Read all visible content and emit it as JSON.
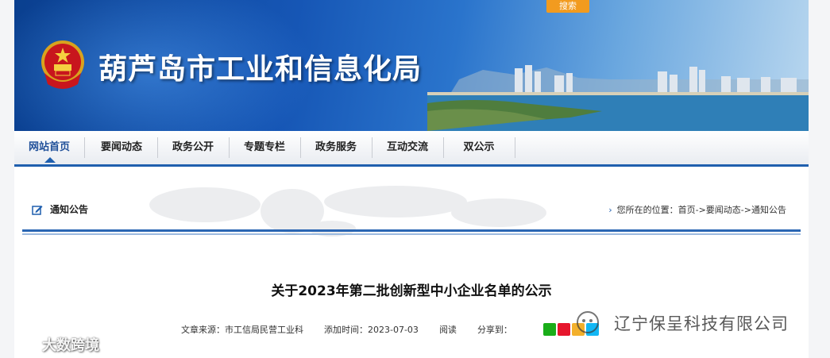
{
  "header": {
    "site_title": "葫芦岛市工业和信息化局",
    "search_label": "搜索"
  },
  "nav": {
    "items": [
      {
        "label": "网站首页",
        "active": true
      },
      {
        "label": "要闻动态"
      },
      {
        "label": "政务公开"
      },
      {
        "label": "专题专栏"
      },
      {
        "label": "政务服务"
      },
      {
        "label": "互动交流"
      },
      {
        "label": "双公示"
      }
    ]
  },
  "section": {
    "title": "通知公告",
    "breadcrumb": "您所在的位置：首页->要闻动态->通知公告",
    "icon": "edit-icon"
  },
  "article": {
    "title": "关于2023年第二批创新型中小企业名单的公示",
    "source": "文章来源：市工信局民营工业科",
    "added": "添加时间：2023-07-03",
    "read": "阅读",
    "share": "分享到："
  },
  "watermarks": {
    "right": "辽宁保呈科技有限公司",
    "left": "大数跨境"
  },
  "colors": {
    "accent": "#1f5fae",
    "search": "#f29b1f",
    "banner_dark": "#0a3f8f"
  }
}
